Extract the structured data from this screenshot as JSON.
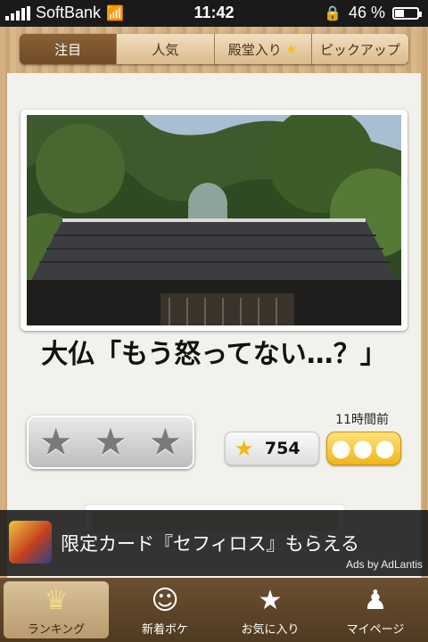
{
  "status_bar": {
    "carrier": "SoftBank",
    "time": "11:42",
    "battery": "46 %",
    "battery_level": 0.46
  },
  "top_tabs": [
    {
      "label": "注目",
      "active": true
    },
    {
      "label": "人気",
      "active": false
    },
    {
      "label": "殿堂入り",
      "active": false,
      "star": "★"
    },
    {
      "label": "ピックアップ",
      "active": false
    }
  ],
  "post": {
    "image_alt": "Great Buddha statue behind a tiled temple roof",
    "caption": "大仏「もう怒ってない…？」",
    "time_ago": "11時間前",
    "rating_stars": [
      "★",
      "★",
      "★"
    ],
    "star_count": "754",
    "more_label": "●●●"
  },
  "ad": {
    "text": "限定カード『セフィロス』もらえる",
    "attribution": "Ads by AdLantis"
  },
  "tab_bar": [
    {
      "label": "ランキング",
      "icon": "crown-icon",
      "glyph": "♛",
      "active": true
    },
    {
      "label": "新着ボケ",
      "icon": "face-icon",
      "glyph": "☺",
      "active": false
    },
    {
      "label": "お気に入り",
      "icon": "star-icon",
      "glyph": "★",
      "active": false
    },
    {
      "label": "マイページ",
      "icon": "person-icon",
      "glyph": "♟",
      "active": false
    }
  ]
}
